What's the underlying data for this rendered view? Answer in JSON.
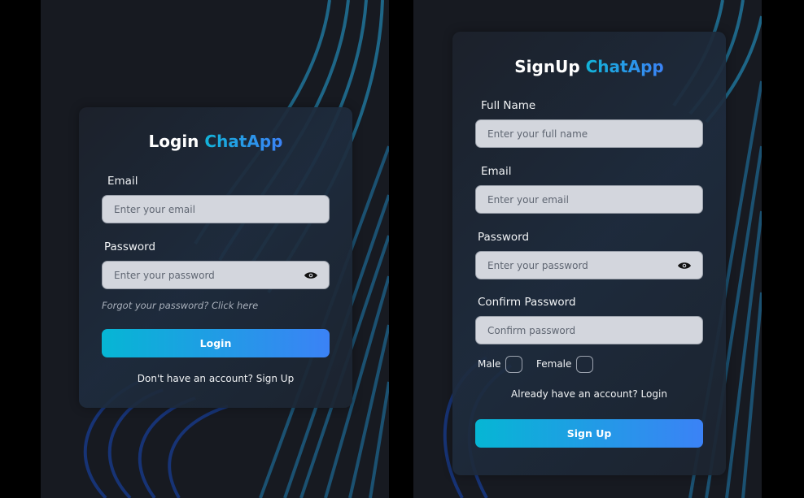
{
  "login": {
    "title_prefix": "Login",
    "title_accent": "ChatApp",
    "email_label": "Email",
    "email_placeholder": "Enter your email",
    "password_label": "Password",
    "password_placeholder": "Enter your password",
    "forgot_link": "Forgot your password? Click here",
    "submit_label": "Login",
    "signup_link": "Don't have an account? Sign Up"
  },
  "signup": {
    "title_prefix": "SignUp",
    "title_accent": "ChatApp",
    "fullname_label": "Full Name",
    "fullname_placeholder": "Enter your full name",
    "email_label": "Email",
    "email_placeholder": "Enter your email",
    "password_label": "Password",
    "password_placeholder": "Enter your password",
    "confirm_label": "Confirm Password",
    "confirm_placeholder": "Confirm password",
    "gender_male": "Male",
    "gender_female": "Female",
    "login_link": "Already have an account? Login",
    "submit_label": "Sign Up"
  },
  "colors": {
    "accent_start": "#06b6d4",
    "accent_end": "#3b82f6",
    "panel_bg": "#171a21"
  }
}
